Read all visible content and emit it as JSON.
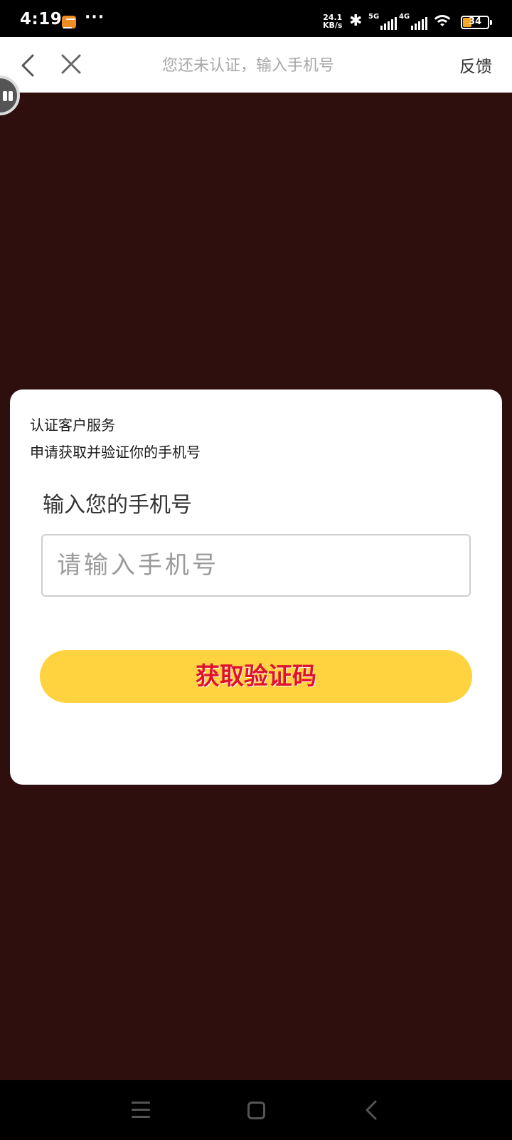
{
  "status_bar": {
    "time": "4:19",
    "notification_icon": "app-notification-icon",
    "more": "···",
    "net_speed_value": "24.1",
    "net_speed_unit": "KB/s",
    "signal1_label": "5G",
    "signal2_label": "4G",
    "battery_level": "34",
    "battery_fraction": 0.34,
    "battery_color": "#f5a623"
  },
  "nav": {
    "title": "您还未认证，输入手机号",
    "feedback_label": "反馈"
  },
  "dialog": {
    "title": "认证客户服务",
    "description": "申请获取并验证你的手机号",
    "field_label": "输入您的手机号",
    "phone_placeholder": "请输入手机号",
    "phone_value": "",
    "button_label": "获取验证码"
  },
  "colors": {
    "background": "#2f0e0e",
    "button_bg": "#ffd23f",
    "button_text": "#e0112b"
  }
}
